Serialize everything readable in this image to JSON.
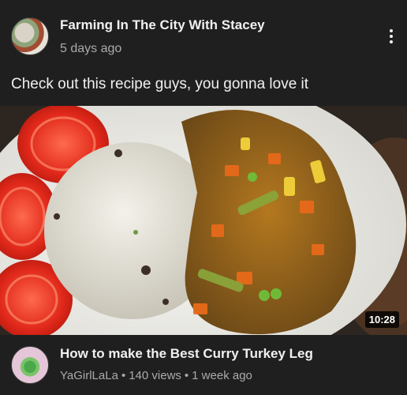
{
  "post": {
    "channel_name": "Farming In The City With Stacey",
    "time_ago": "5 days ago",
    "text": "Check out this recipe guys, you gonna love it",
    "menu_icon": "more-vert-icon"
  },
  "video": {
    "duration": "10:28",
    "title": "How to make the Best Curry Turkey Leg",
    "channel": "YaGirlLaLa",
    "views": "140 views",
    "age": "1 week ago",
    "separator": "•"
  },
  "colors": {
    "background": "#1f1f1f",
    "primary_text": "#f1f1f1",
    "secondary_text": "#aaaaaa"
  }
}
